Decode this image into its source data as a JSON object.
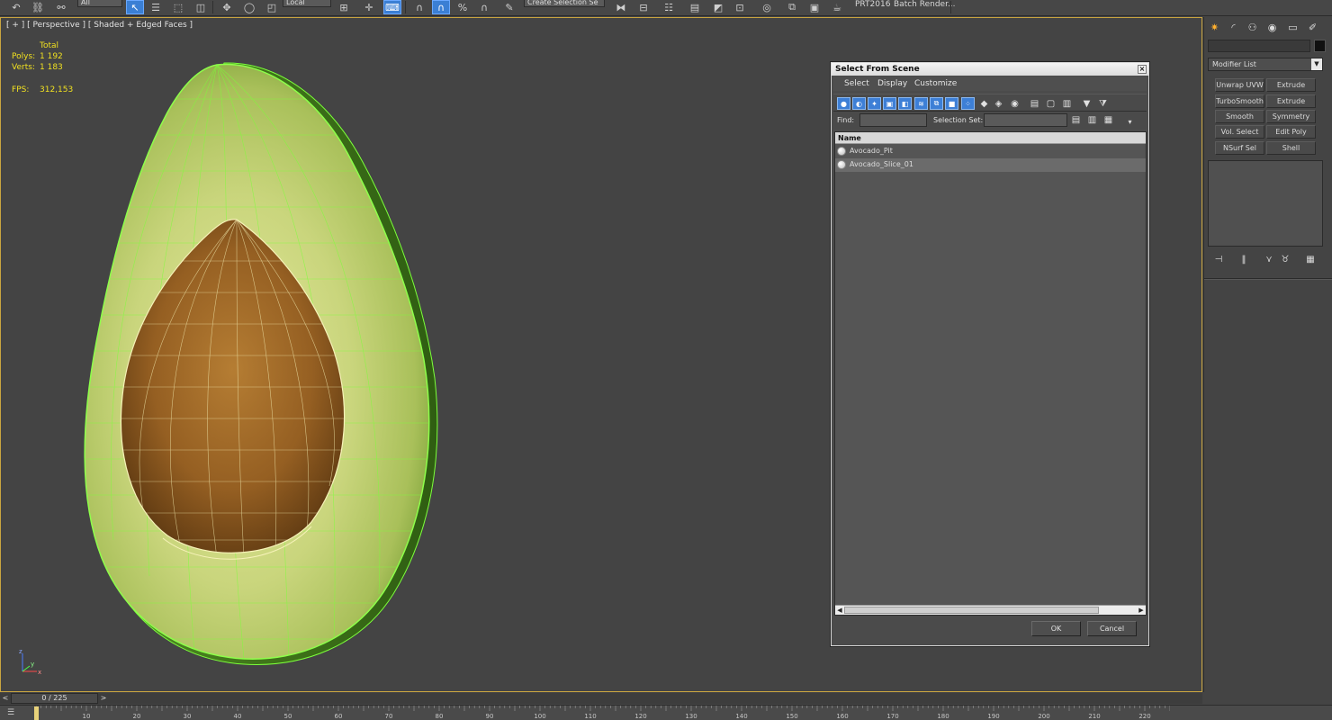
{
  "toolbar": {
    "coord_dropdown": "Local",
    "select_filter": "All",
    "named_selection": "Create Selection Se",
    "snap_percent_label": "%",
    "project_label": "PRT2016",
    "batch_render_label": "Batch Render..."
  },
  "viewport": {
    "label": "[ + ] [ Perspective ] [ Shaded + Edged Faces ]",
    "stats": {
      "header": "Total",
      "polys_label": "Polys:",
      "polys_value": "1 192",
      "verts_label": "Verts:",
      "verts_value": "1 183",
      "fps_label": "FPS:",
      "fps_value": "312,153"
    },
    "axis": {
      "x": "x",
      "y": "y",
      "z": "z"
    }
  },
  "dialog": {
    "title": "Select From Scene",
    "close": "×",
    "menus": [
      "Select",
      "Display",
      "Customize"
    ],
    "find_label": "Find:",
    "find_value": "",
    "selection_set_label": "Selection Set:",
    "selection_set_value": "",
    "column_name": "Name",
    "rows": [
      {
        "name": "Avocado_Pit",
        "selected": false
      },
      {
        "name": "Avocado_Slice_01",
        "selected": true
      }
    ],
    "ok": "OK",
    "cancel": "Cancel"
  },
  "command_panel": {
    "modifier_list": "Modifier List",
    "modifiers": [
      [
        "Unwrap UVW",
        "Extrude"
      ],
      [
        "TurboSmooth",
        "Extrude"
      ],
      [
        "Smooth",
        "Symmetry"
      ],
      [
        "Vol. Select",
        "Edit Poly"
      ],
      [
        "NSurf Sel",
        "Shell"
      ]
    ]
  },
  "timeline": {
    "frame_display": "0 / 225",
    "ticks": [
      "10",
      "20",
      "30",
      "40",
      "50",
      "60",
      "70",
      "80",
      "90",
      "100",
      "110",
      "120",
      "130",
      "140",
      "150",
      "160",
      "170",
      "180",
      "190",
      "200",
      "210",
      "220"
    ]
  },
  "colors": {
    "viewport_bg": "#444444",
    "active_viewport_border": "#c9a540",
    "wire": "#7cff3a",
    "stats": "#f0e020",
    "selection_blue": "#3b7fd4"
  }
}
